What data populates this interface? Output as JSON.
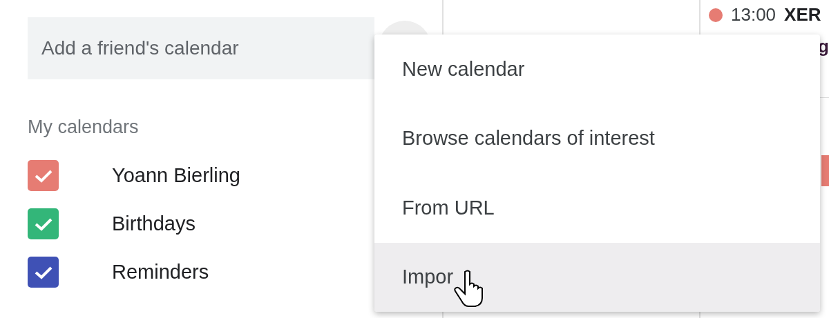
{
  "add_friend_field": {
    "placeholder": "Add a friend's calendar"
  },
  "my_calendars": {
    "heading": "My calendars",
    "items": [
      {
        "label": "Yoann Bierling",
        "checked": true,
        "color": "#e67c73"
      },
      {
        "label": "Birthdays",
        "checked": true,
        "color": "#33b679"
      },
      {
        "label": "Reminders",
        "checked": true,
        "color": "#3f51b5"
      }
    ]
  },
  "events": [
    {
      "time": "13:00",
      "title": "XER",
      "color": "#e67c73"
    }
  ],
  "event_fragment": "g",
  "menu": {
    "items": [
      {
        "label": "New calendar",
        "highlighted": false
      },
      {
        "label": "Browse calendars of interest",
        "highlighted": false
      },
      {
        "label": "From URL",
        "highlighted": false
      },
      {
        "label": "Impor",
        "highlighted": true
      }
    ]
  }
}
